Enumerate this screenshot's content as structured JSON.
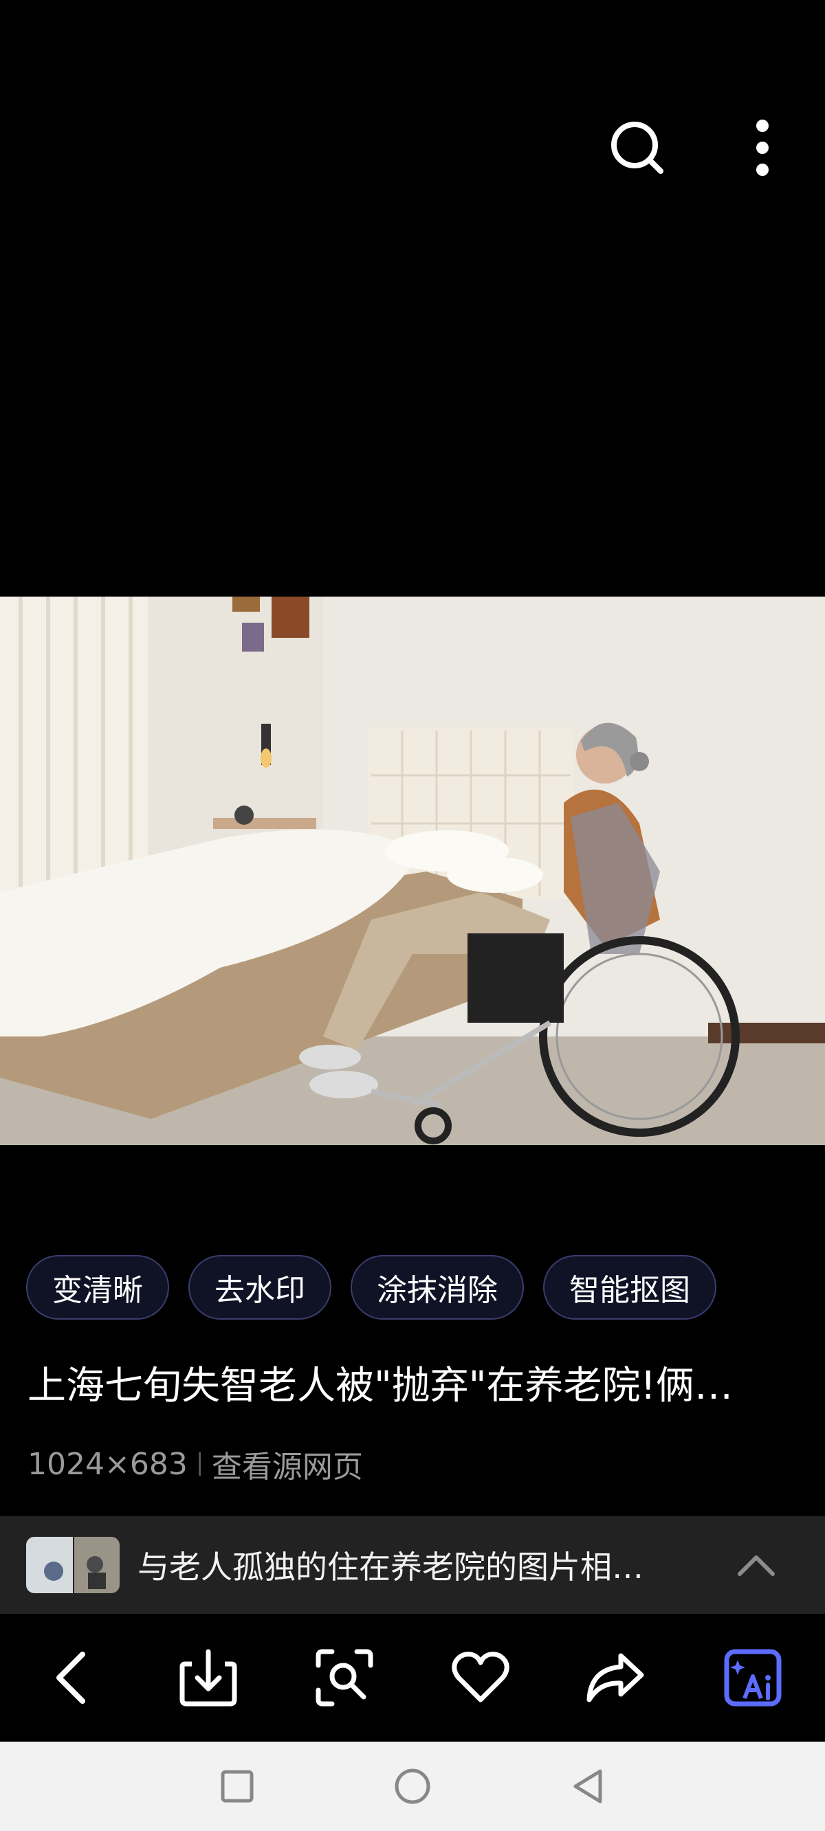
{
  "top_bar": {
    "search_icon": "search-icon",
    "more_icon": "more-vertical-icon"
  },
  "image": {
    "description_icon": "photo-elderly-woman-wheelchair-bedroom"
  },
  "tools": [
    {
      "label": "变清晰"
    },
    {
      "label": "去水印"
    },
    {
      "label": "涂抹消除"
    },
    {
      "label": "智能抠图"
    }
  ],
  "result": {
    "title": "上海七旬失智老人被\"抛弃\"在养老院!俩…",
    "dimensions": "1024×683",
    "source_link": "查看源网页"
  },
  "related": {
    "text": "与老人孤独的住在养老院的图片相…",
    "chevron_icon": "chevron-up-icon"
  },
  "toolbar": {
    "back_icon": "back-icon",
    "download_icon": "download-icon",
    "lens_icon": "image-search-icon",
    "favorite_icon": "heart-icon",
    "share_icon": "share-icon",
    "ai_icon": "ai-icon"
  },
  "colors": {
    "chip_border": "#3b3d6e",
    "ai_accent": "#5b6cff"
  }
}
